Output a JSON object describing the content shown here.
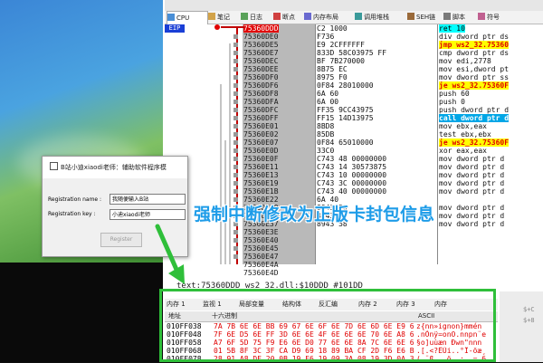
{
  "debugger": {
    "tabs": [
      {
        "label": "CPU",
        "icon": "cpu-icon"
      },
      {
        "label": "笔记",
        "icon": "notes-icon"
      },
      {
        "label": "日志",
        "icon": "log-icon"
      },
      {
        "label": "断点",
        "icon": "breakpoint-icon"
      },
      {
        "label": "内存布局",
        "icon": "memory-map-icon"
      },
      {
        "label": "调用堆栈",
        "icon": "call-stack-icon"
      },
      {
        "label": "SEH链",
        "icon": "seh-icon"
      },
      {
        "label": "脚本",
        "icon": "script-icon"
      },
      {
        "label": "符号",
        "icon": "symbol-icon"
      }
    ],
    "eip_label": "EIP",
    "addresses": [
      "75360DDD",
      "75360DE0",
      "75360DE5",
      "75360DE7",
      "75360DEC",
      "75360DEE",
      "75360DF0",
      "75360DF6",
      "75360DF8",
      "75360DFA",
      "75360DFC",
      "75360DFF",
      "75360E01",
      "75360E02",
      "75360E07",
      "75360E0D",
      "75360E0F",
      "75360E11",
      "75360E13",
      "75360E19",
      "75360E1B",
      "75360E22",
      "75360E29",
      "75360E30",
      "75360E37",
      "75360E3E",
      "75360E40",
      "75360E45",
      "75360E47",
      "75360E4A",
      "75360E4D"
    ],
    "bytes": [
      "C2 1000",
      "F736",
      "E9 2CFFFFFF",
      "833D 58C03975 FF",
      "BF 7B270000",
      "8B75 EC",
      "8975 F0",
      "0F84 28010000",
      "6A 60",
      "6A 00",
      "FF35 9CC43975",
      "FF15 14D13975",
      "8BD8",
      "85DB",
      "0F84 65010000",
      "33C0",
      "C743 48 00000000",
      "C743 14 30573875",
      "C743 10 00000000",
      "C743 3C 00000000",
      "C743 40 00000000",
      "6A 40",
      "8943 50",
      "8943 54",
      "8943 58",
      "",
      ""
    ],
    "disasm": [
      {
        "text": "ret 10",
        "style": "ret"
      },
      {
        "text": "div dword ptr ds",
        "style": ""
      },
      {
        "text": "jmp ws2_32.75360",
        "style": "red"
      },
      {
        "text": "cmp dword ptr ds",
        "style": ""
      },
      {
        "text": "mov edi,2778",
        "style": ""
      },
      {
        "text": "mov esi,dword pt",
        "style": ""
      },
      {
        "text": "mov dword ptr ss",
        "style": ""
      },
      {
        "text": "je ws2_32.75360F",
        "style": "red"
      },
      {
        "text": "push 60",
        "style": ""
      },
      {
        "text": "push 0",
        "style": ""
      },
      {
        "text": "push dword ptr d",
        "style": ""
      },
      {
        "text": "call dword ptr d",
        "style": "call"
      },
      {
        "text": "mov ebx,eax",
        "style": ""
      },
      {
        "text": "test ebx,ebx",
        "style": ""
      },
      {
        "text": "je ws2_32.75360F",
        "style": "red"
      },
      {
        "text": "xor eax,eax",
        "style": ""
      },
      {
        "text": "mov dword ptr d",
        "style": ""
      },
      {
        "text": "mov dword ptr d",
        "style": ""
      },
      {
        "text": "mov dword ptr d",
        "style": ""
      },
      {
        "text": "mov dword ptr d",
        "style": ""
      },
      {
        "text": "mov dword ptr d",
        "style": ""
      },
      {
        "text": "",
        "style": ""
      },
      {
        "text": "mov dword ptr d",
        "style": ""
      },
      {
        "text": "mov dword ptr d",
        "style": ""
      },
      {
        "text": "mov dword ptr d",
        "style": ""
      }
    ],
    "info_line": "text:75360DDD ws2_32.dll:$10DDD #101DD"
  },
  "annotation": "强制中断修改为正版卡封包信息",
  "dialog": {
    "title": "B站小迪xiaodi老师：辅助软件程序模",
    "reg_name_label": "Registration name :",
    "reg_name_value": "我随便输入B站",
    "reg_key_label": "Registration key :",
    "reg_key_value": "小迪xiaodi老师",
    "register_button": "Register"
  },
  "memory": {
    "tabs": [
      "内存 1",
      "监视 1",
      "局部变量",
      "结构体",
      "反汇编",
      "内存 2",
      "内存 3",
      "内存"
    ],
    "col_address": "地址",
    "col_hex": "十六进制",
    "col_ascii": "ASCII",
    "rows": [
      {
        "addr": "010FF038",
        "hex": "7A 7B 6E 6E BB 69 67 6E 6F 6E 7D 6E 6D 6E E9 6E",
        "ascii": "z{nn»ignon}mmén"
      },
      {
        "addr": "010FF048",
        "hex": "7F 6E D5 6E FF 3D 6E 6E 4F 6E 6E 6E 70 6E A8 65",
        "ascii": ".nÕnÿ=onO.nnpn¨e"
      },
      {
        "addr": "010FF058",
        "hex": "A7 6F 5D 75 F9 E6 6E D0 77 6E 6E 8A 7C 6E 6E 6E",
        "ascii": "§o]uùæn Ðwn\"nnn"
      },
      {
        "addr": "010FF068",
        "hex": "01 5B 8F 3C 3F CA D9 69 18 89 BA CF 2D F6 E6 B8",
        "ascii": ".[.<?ÊÙi..°Ï-öæ¸"
      },
      {
        "addr": "010FF078",
        "hex": "28 91 A8 DF 20 0B 19 F6 19 09 3A 08 19 3D 0A 36",
        "ascii": "(.¨ß ..ö..:..=.6"
      }
    ]
  },
  "right_panel": [
    "$+C",
    "$+8"
  ],
  "colors": {
    "annotation": "#1e9ce8",
    "highlight_box": "#2fbf3a",
    "eip": "#1a3fd6",
    "current_line": "#e00000"
  }
}
